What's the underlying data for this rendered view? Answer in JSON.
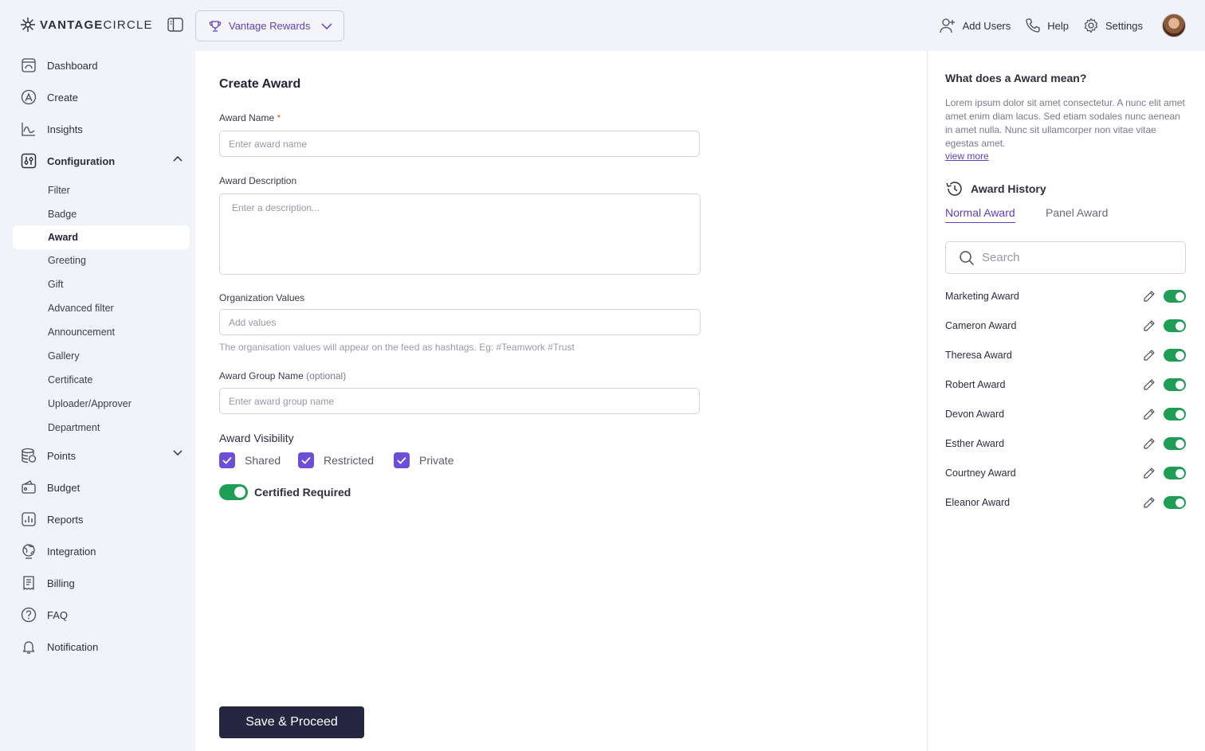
{
  "header": {
    "logo_bold": "VANTAGE",
    "logo_light": "CIRCLE",
    "program_label": "Vantage Rewards",
    "actions": [
      {
        "label": "Add Users",
        "icon": "add-user-icon"
      },
      {
        "label": "Help",
        "icon": "phone-icon"
      },
      {
        "label": "Settings",
        "icon": "gear-icon"
      }
    ]
  },
  "sidebar": {
    "items": [
      {
        "label": "Dashboard",
        "icon": "dashboard-icon"
      },
      {
        "label": "Create",
        "icon": "create-icon"
      },
      {
        "label": "Insights",
        "icon": "insights-icon"
      },
      {
        "label": "Configuration",
        "icon": "configuration-icon"
      },
      {
        "label": "Points",
        "icon": "points-icon"
      },
      {
        "label": "Budget",
        "icon": "budget-icon"
      },
      {
        "label": "Reports",
        "icon": "reports-icon"
      },
      {
        "label": "Integration",
        "icon": "integration-icon"
      },
      {
        "label": "Billing",
        "icon": "billing-icon"
      },
      {
        "label": "FAQ",
        "icon": "faq-icon"
      },
      {
        "label": "Notification",
        "icon": "bell-icon"
      }
    ],
    "config_subitems": [
      "Filter",
      "Badge",
      "Award",
      "Greeting",
      "Gift",
      "Advanced filter",
      "Announcement",
      "Gallery",
      "Certificate",
      "Uploader/Approver",
      "Department"
    ],
    "active_subitem": "Award"
  },
  "form": {
    "title": "Create Award",
    "award_name_label": "Award Name",
    "required_mark": "*",
    "award_name_placeholder": "Enter award name",
    "description_label": "Award Description",
    "description_placeholder": "Enter a description...",
    "org_values_label": "Organization Values",
    "org_values_placeholder": "Add values",
    "org_values_hint": "The organisation values will appear on the feed as hashtags. Eg: #Teamwork #Trust",
    "group_label": "Award Group Name",
    "group_optional": "(optional)",
    "group_placeholder": "Enter award group name",
    "visibility_label": "Award Visibility",
    "visibility_options": [
      {
        "label": "Shared",
        "checked": true
      },
      {
        "label": "Restricted",
        "checked": true
      },
      {
        "label": "Private",
        "checked": true
      }
    ],
    "certified_label": "Certified Required",
    "certified_on": true,
    "save_label": "Save & Proceed"
  },
  "panel": {
    "title": "What does a Award mean?",
    "description": "Lorem ipsum dolor sit amet consectetur. A nunc elit amet amet enim diam lacus. Sed etiam sodales nunc aenean in amet nulla. Nunc sit ullamcorper non vitae vitae egestas amet.",
    "view_more": "view more",
    "history_title": "Award History",
    "tabs": [
      "Normal Award",
      "Panel Award"
    ],
    "active_tab": "Normal Award",
    "search_placeholder": "Search",
    "awards": [
      {
        "name": "Marketing Award",
        "enabled": true
      },
      {
        "name": "Cameron Award",
        "enabled": true
      },
      {
        "name": "Theresa Award",
        "enabled": true
      },
      {
        "name": "Robert Award",
        "enabled": true
      },
      {
        "name": "Devon Award",
        "enabled": true
      },
      {
        "name": "Esther Award",
        "enabled": true
      },
      {
        "name": "Courtney Award",
        "enabled": true
      },
      {
        "name": "Eleanor Award",
        "enabled": true
      }
    ]
  },
  "colors": {
    "accent": "#5e3fc4",
    "checkbox": "#6c4fd6",
    "toggle_on": "#1e9e54",
    "button_dark": "#262642"
  }
}
